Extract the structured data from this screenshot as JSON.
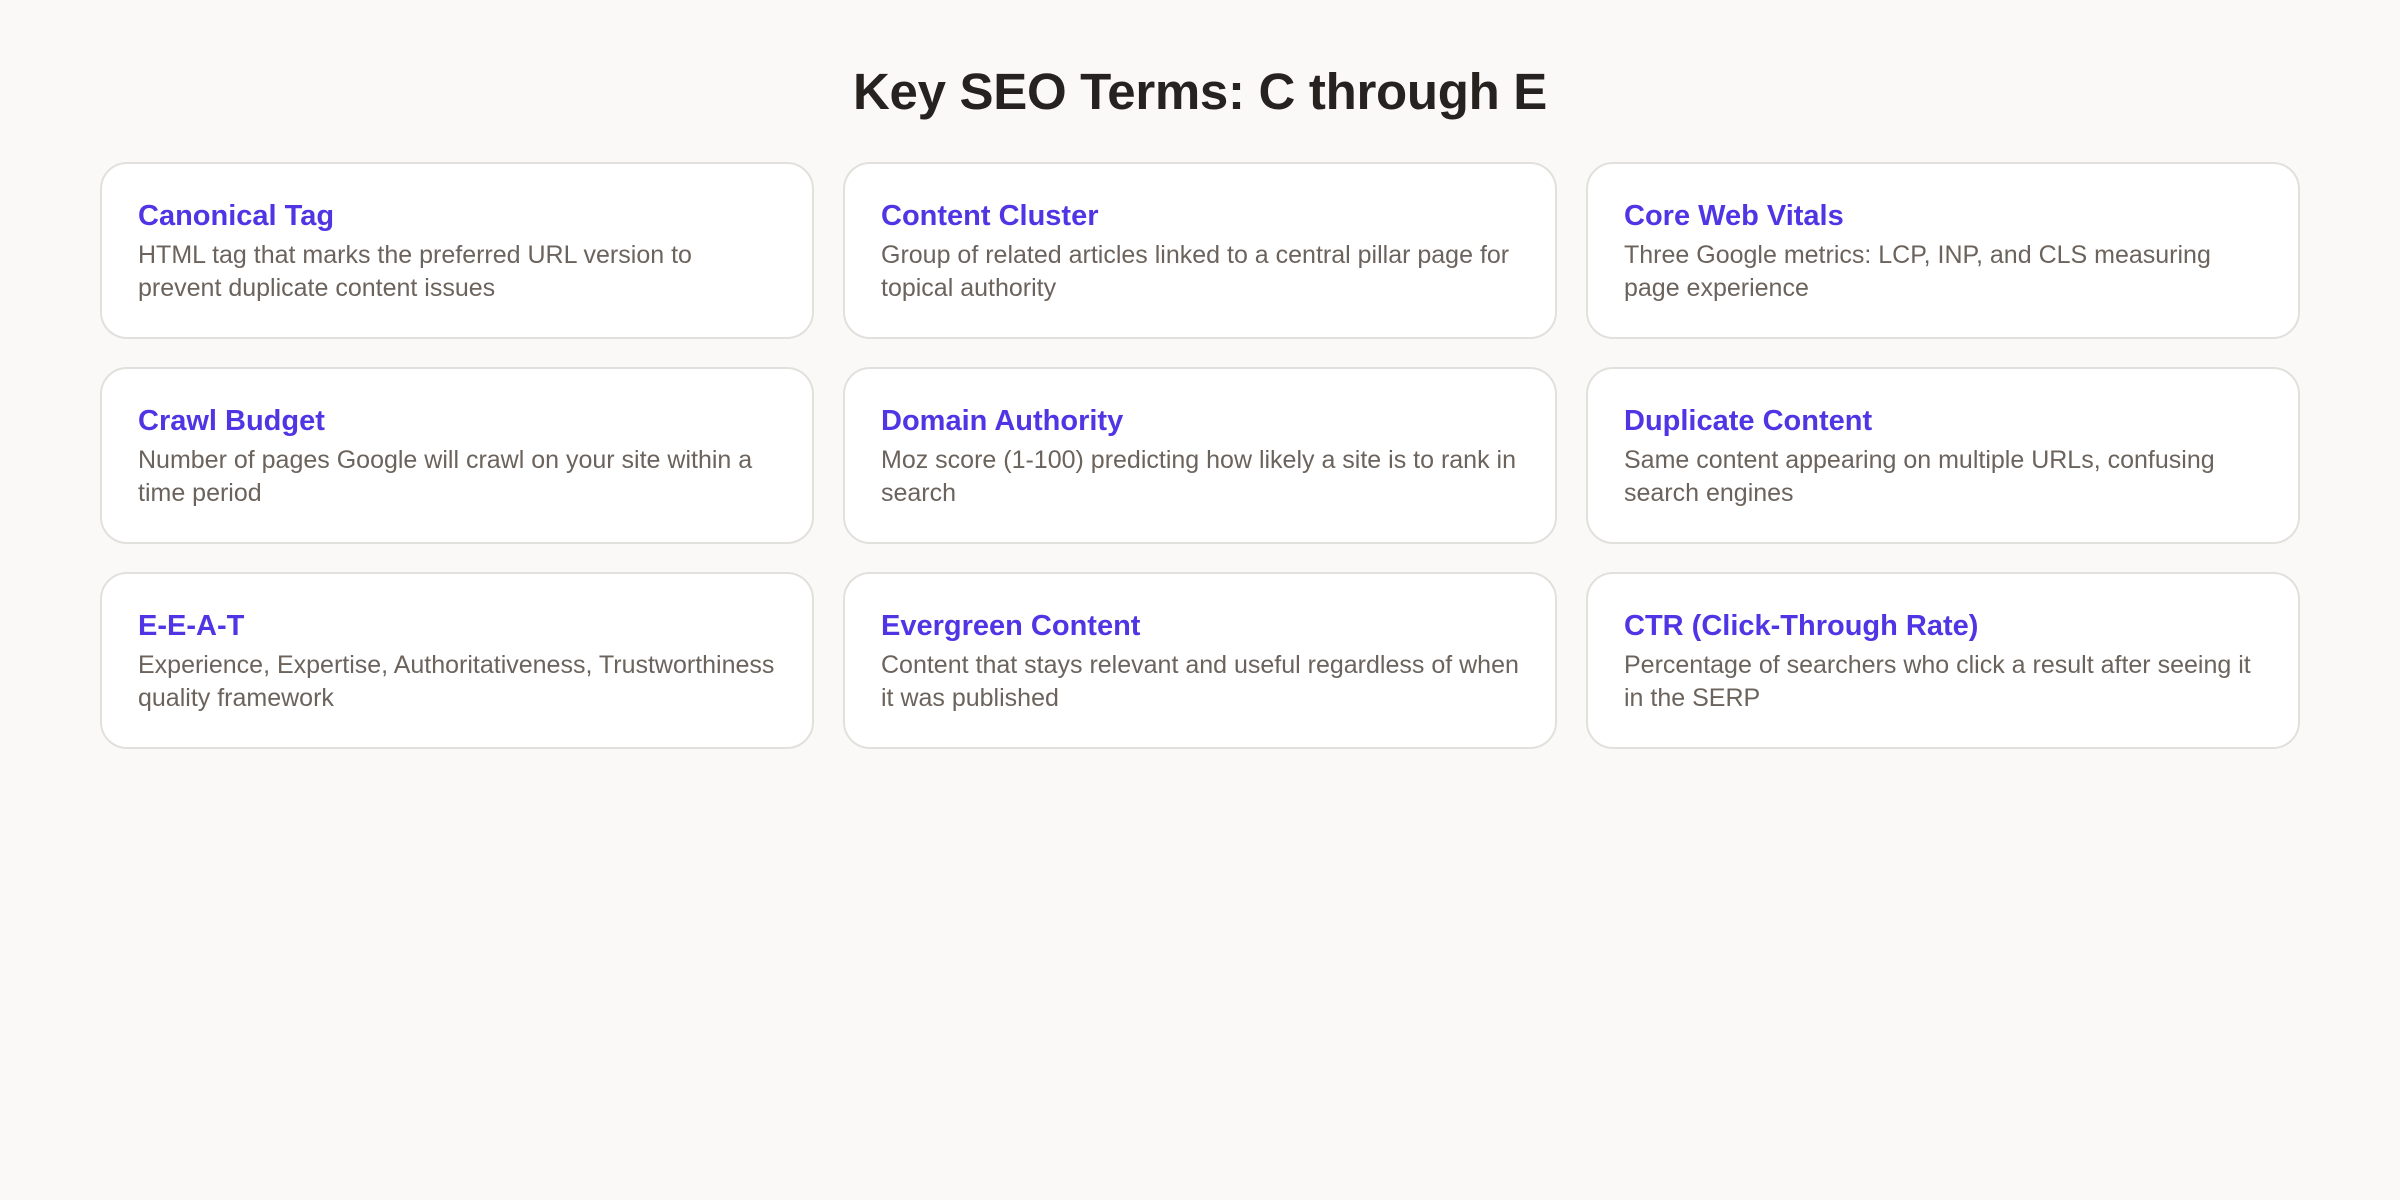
{
  "page": {
    "title": "Key SEO Terms: C through E"
  },
  "colors": {
    "background": "#faf9f7",
    "card_background": "#ffffff",
    "card_border": "#e2e0dd",
    "term_color": "#4f35e4",
    "title_color": "#26221f",
    "description_color": "#6b635c"
  },
  "terms": [
    {
      "term": "Canonical Tag",
      "definition": "HTML tag that marks the preferred URL version to prevent duplicate content issues"
    },
    {
      "term": "Content Cluster",
      "definition": "Group of related articles linked to a central pillar page for topical authority"
    },
    {
      "term": "Core Web Vitals",
      "definition": "Three Google metrics: LCP, INP, and CLS measuring page experience"
    },
    {
      "term": "Crawl Budget",
      "definition": "Number of pages Google will crawl on your site within a time period"
    },
    {
      "term": "Domain Authority",
      "definition": "Moz score (1-100) predicting how likely a site is to rank in search"
    },
    {
      "term": "Duplicate Content",
      "definition": "Same content appearing on multiple URLs, confusing search engines"
    },
    {
      "term": "E-E-A-T",
      "definition": "Experience, Expertise, Authoritativeness, Trustworthiness quality framework"
    },
    {
      "term": "Evergreen Content",
      "definition": "Content that stays relevant and useful regardless of when it was published"
    },
    {
      "term": "CTR (Click-Through Rate)",
      "definition": "Percentage of searchers who click a result after seeing it in the SERP"
    }
  ]
}
